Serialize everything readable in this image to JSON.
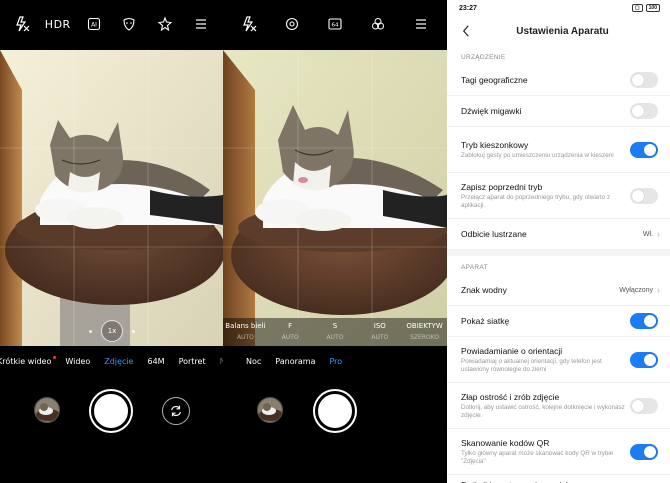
{
  "camera_left": {
    "topbar": [
      "flash-off-icon",
      "HDR",
      "ai-icon",
      "beauty-icon",
      "filter-icon",
      "menu-icon"
    ],
    "hdr_label": "HDR",
    "ai_label": "AI",
    "zoom": "1x",
    "modes": [
      {
        "label": "Krótkie wideo",
        "active": false,
        "dot": true
      },
      {
        "label": "Wideo",
        "active": false
      },
      {
        "label": "Zdjęcie",
        "active": true
      },
      {
        "label": "64M",
        "active": false
      },
      {
        "label": "Portret",
        "active": false
      },
      {
        "label": "N",
        "active": false,
        "dim": true
      }
    ]
  },
  "camera_right": {
    "topbar": [
      "flash-off-icon",
      "lens-icon",
      "64m-icon",
      "filter-icon",
      "menu-icon"
    ],
    "res_label": "64",
    "pro_params": [
      {
        "label": "Balans bieli",
        "value": "AUTO"
      },
      {
        "label": "F",
        "value": "AUTO"
      },
      {
        "label": "S",
        "value": "AUTO"
      },
      {
        "label": "ISO",
        "value": "AUTO"
      },
      {
        "label": "OBIEKTYW",
        "value": "SZEROKO"
      }
    ],
    "modes": [
      {
        "label": "Noc",
        "active": false
      },
      {
        "label": "Panorama",
        "active": false
      },
      {
        "label": "Pro",
        "active": true
      }
    ]
  },
  "settings": {
    "status": {
      "time": "23:27",
      "sig": "▢",
      "battery": "100"
    },
    "title": "Ustawienia Aparatu",
    "section_device": "URZĄDZENIE",
    "section_camera": "APARAT",
    "rows_device": [
      {
        "title": "Tagi geograficzne",
        "subtitle": "",
        "type": "toggle",
        "on": false
      },
      {
        "title": "Dźwięk migawki",
        "subtitle": "",
        "type": "toggle",
        "on": false
      },
      {
        "title": "Tryb kieszonkowy",
        "subtitle": "Zablokuj gesty po umieszczeniu urządzenia w kieszeni",
        "type": "toggle",
        "on": true
      },
      {
        "title": "Zapisz poprzedni tryb",
        "subtitle": "Przełącz aparat do poprzedniego trybu, gdy otwarto z aplikacji.",
        "type": "toggle",
        "on": false
      },
      {
        "title": "Odbicie lustrzane",
        "subtitle": "",
        "type": "value",
        "value": "Wł."
      }
    ],
    "rows_camera": [
      {
        "title": "Znak wodny",
        "subtitle": "",
        "type": "value",
        "value": "Wyłączony"
      },
      {
        "title": "Pokaż siatkę",
        "subtitle": "",
        "type": "toggle",
        "on": true
      },
      {
        "title": "Powiadamianie o orientacji",
        "subtitle": "Powiadamiaj o aktualnej orientacji, gdy telefon jest ustawiony równolegle do ziemi",
        "type": "toggle",
        "on": true
      },
      {
        "title": "Złap ostrość i zrób zdjęcie",
        "subtitle": "Dotknij, aby ustawić ostrość, kolejne dotknięcie i wykonasz zdjęcie.",
        "type": "toggle",
        "on": false
      },
      {
        "title": "Skanowanie kodów QR",
        "subtitle": "Tylko główny aparat może skanować kody QR w trybie \"Zdjęcia\"",
        "type": "toggle",
        "on": true
      },
      {
        "title": "Dotknij i przytrzymaj przycisk",
        "subtitle": "",
        "type": "cut",
        "on": false
      }
    ]
  },
  "colors": {
    "accent": "#1b7cf3",
    "mode_active": "#3d95ff"
  }
}
